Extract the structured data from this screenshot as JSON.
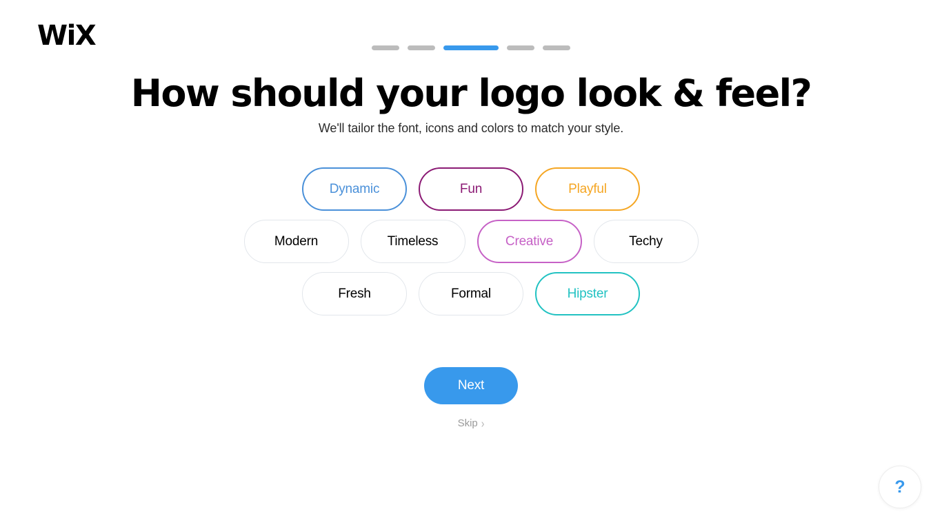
{
  "brand": {
    "logo_text": "WiX"
  },
  "progress": {
    "total_steps": 5,
    "current_step": 3,
    "segments": [
      {
        "state": "inactive"
      },
      {
        "state": "inactive"
      },
      {
        "state": "active"
      },
      {
        "state": "inactive"
      },
      {
        "state": "inactive"
      }
    ],
    "active_color": "#3899ec",
    "inactive_color": "#bcbcbc"
  },
  "header": {
    "title": "How should your logo look & feel?",
    "subtitle": "We'll tailor the font, icons and colors to match your style."
  },
  "style_chips": {
    "rows": [
      [
        {
          "label": "Dynamic",
          "selected": true,
          "color": "#4a90d9"
        },
        {
          "label": "Fun",
          "selected": true,
          "color": "#8b1a74"
        },
        {
          "label": "Playful",
          "selected": true,
          "color": "#f5a623"
        }
      ],
      [
        {
          "label": "Modern",
          "selected": false,
          "color": "#000000"
        },
        {
          "label": "Timeless",
          "selected": false,
          "color": "#000000"
        },
        {
          "label": "Creative",
          "selected": true,
          "color": "#c661c6"
        },
        {
          "label": "Techy",
          "selected": false,
          "color": "#000000"
        }
      ],
      [
        {
          "label": "Fresh",
          "selected": false,
          "color": "#000000"
        },
        {
          "label": "Formal",
          "selected": false,
          "color": "#000000"
        },
        {
          "label": "Hipster",
          "selected": true,
          "color": "#21c2c2"
        }
      ]
    ],
    "default_border_color": "#e2e6eb"
  },
  "actions": {
    "next_label": "Next",
    "skip_label": "Skip",
    "skip_chevron": "›"
  },
  "help": {
    "icon_glyph": "?",
    "color": "#3899ec"
  }
}
